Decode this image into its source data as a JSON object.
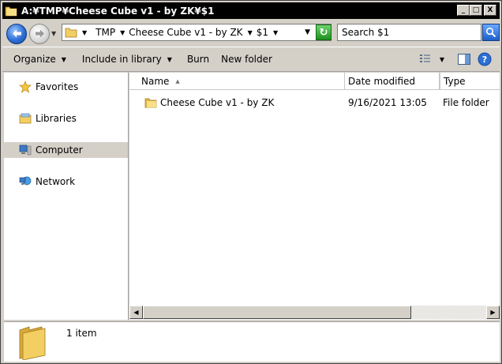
{
  "window": {
    "title": "A:¥TMP¥Cheese Cube v1 - by ZK¥$1"
  },
  "title_buttons": {
    "minimize": "_",
    "maximize": "□",
    "close": "X"
  },
  "address_bar": {
    "breadcrumbs": [
      "TMP",
      "Cheese Cube v1 - by ZK",
      "$1"
    ],
    "search_placeholder": "Search $1"
  },
  "toolbar": {
    "organize": "Organize",
    "include_in_library": "Include in library",
    "burn": "Burn",
    "new_folder": "New folder"
  },
  "nav_pane": {
    "items": [
      {
        "label": "Favorites",
        "icon": "star-icon"
      },
      {
        "label": "Libraries",
        "icon": "library-icon"
      },
      {
        "label": "Computer",
        "icon": "computer-icon",
        "selected": true
      },
      {
        "label": "Network",
        "icon": "network-icon"
      }
    ]
  },
  "columns": {
    "name": "Name",
    "date_modified": "Date modified",
    "type": "Type"
  },
  "files": [
    {
      "name": "Cheese Cube v1 - by ZK",
      "date_modified": "9/16/2021 13:05",
      "type": "File folder"
    }
  ],
  "details": {
    "count": "1 item"
  },
  "colors": {
    "titlebar_bg": "#000000",
    "window_bg": "#d4d0c8",
    "folder_yellow": "#f3cf63"
  }
}
